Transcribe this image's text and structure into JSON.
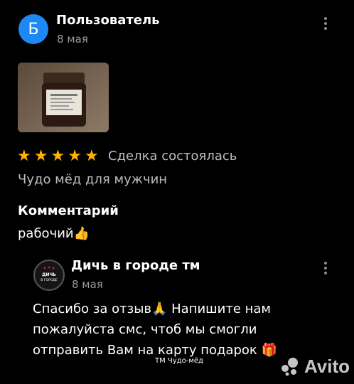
{
  "review": {
    "avatar_letter": "Б",
    "author": "Пользователь",
    "date": "8 мая",
    "rating": 5,
    "star_glyph": "★",
    "deal_status": "Сделка состоялась",
    "product": "Чудо мёд для мужчин",
    "comment_label": "Комментарий",
    "comment_text": "рабочий👍"
  },
  "reply": {
    "avatar_text": "ДИЧЬ В ГОРОДЕ",
    "author": "Дичь в городе тм",
    "date": "8 мая",
    "text": "Спасибо за отзыв🙏 Напишите нам пожалуйста смс, чтоб мы смогли отправить Вам на карту подарок 🎁"
  },
  "watermark": {
    "small": "ТМ Чудо-мёд",
    "brand": "Avito"
  },
  "colors": {
    "accent_blue": "#1e88f5",
    "star": "#ffb400"
  }
}
